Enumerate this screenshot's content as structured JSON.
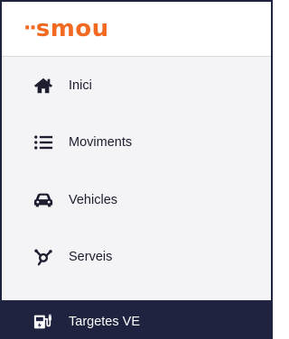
{
  "brand": {
    "logo_text": "smou",
    "logo_prefix": "··",
    "accent_color": "#f26a21"
  },
  "sidebar": {
    "items": [
      {
        "label": "Inici",
        "icon": "home-icon",
        "active": false
      },
      {
        "label": "Moviments",
        "icon": "list-icon",
        "active": false
      },
      {
        "label": "Vehicles",
        "icon": "car-icon",
        "active": false
      },
      {
        "label": "Serveis",
        "icon": "services-icon",
        "active": false
      },
      {
        "label": "Targetes VE",
        "icon": "ev-card-icon",
        "active": true
      }
    ],
    "active_background": "#1f2340"
  }
}
